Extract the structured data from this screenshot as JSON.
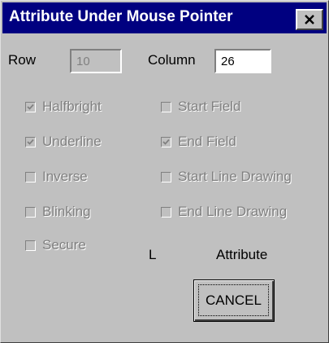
{
  "window": {
    "title": "Attribute Under Mouse Pointer",
    "close_icon": "close-icon"
  },
  "fields": {
    "row_label": "Row",
    "row_value": "10",
    "column_label": "Column",
    "column_value": "26"
  },
  "checkboxes": [
    {
      "label": "Halfbright",
      "checked": true
    },
    {
      "label": "Underline",
      "checked": true
    },
    {
      "label": "Inverse",
      "checked": false
    },
    {
      "label": "Blinking",
      "checked": false
    },
    {
      "label": "Secure",
      "checked": false
    },
    {
      "label": "Start Field",
      "checked": false
    },
    {
      "label": "End Field",
      "checked": true
    },
    {
      "label": "Start Line Drawing",
      "checked": false
    },
    {
      "label": "End Line Drawing",
      "checked": false
    }
  ],
  "attribute": {
    "value": "L",
    "label": "Attribute"
  },
  "buttons": {
    "cancel": "CANCEL"
  },
  "colors": {
    "titlebar": "#000080",
    "face": "#c0c0c0",
    "disabled_text": "#808080"
  }
}
